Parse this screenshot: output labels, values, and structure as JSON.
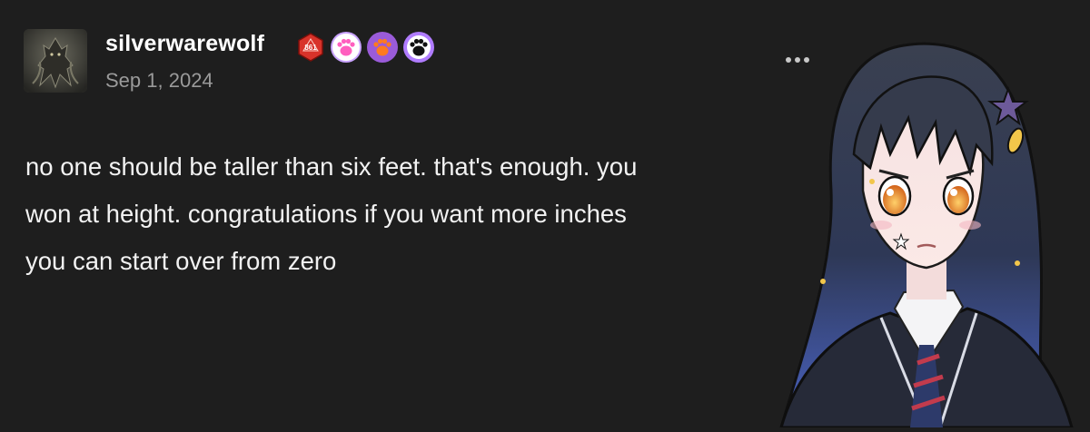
{
  "post": {
    "username": "silverwarewolf",
    "date": "Sep 1, 2024",
    "badges": [
      {
        "icon": "d20-dice-icon",
        "label": "861",
        "color": "#d8332a"
      },
      {
        "icon": "paw-icon",
        "color": "#c9a3ff",
        "fill": "#ff5fbf"
      },
      {
        "icon": "paw-icon",
        "color": "#9a5bd9",
        "fill": "#ff7a1f"
      },
      {
        "icon": "paw-icon",
        "color": "#b07cff",
        "fill": "#111111"
      }
    ],
    "body_lines": [
      "no one should be taller than six feet. that's enough. you",
      "won at height. congratulations if you want more inches",
      "you can start over from zero"
    ]
  },
  "overlay": {
    "icon": "anime-character-illustration",
    "accent": "#2a2f4a"
  }
}
